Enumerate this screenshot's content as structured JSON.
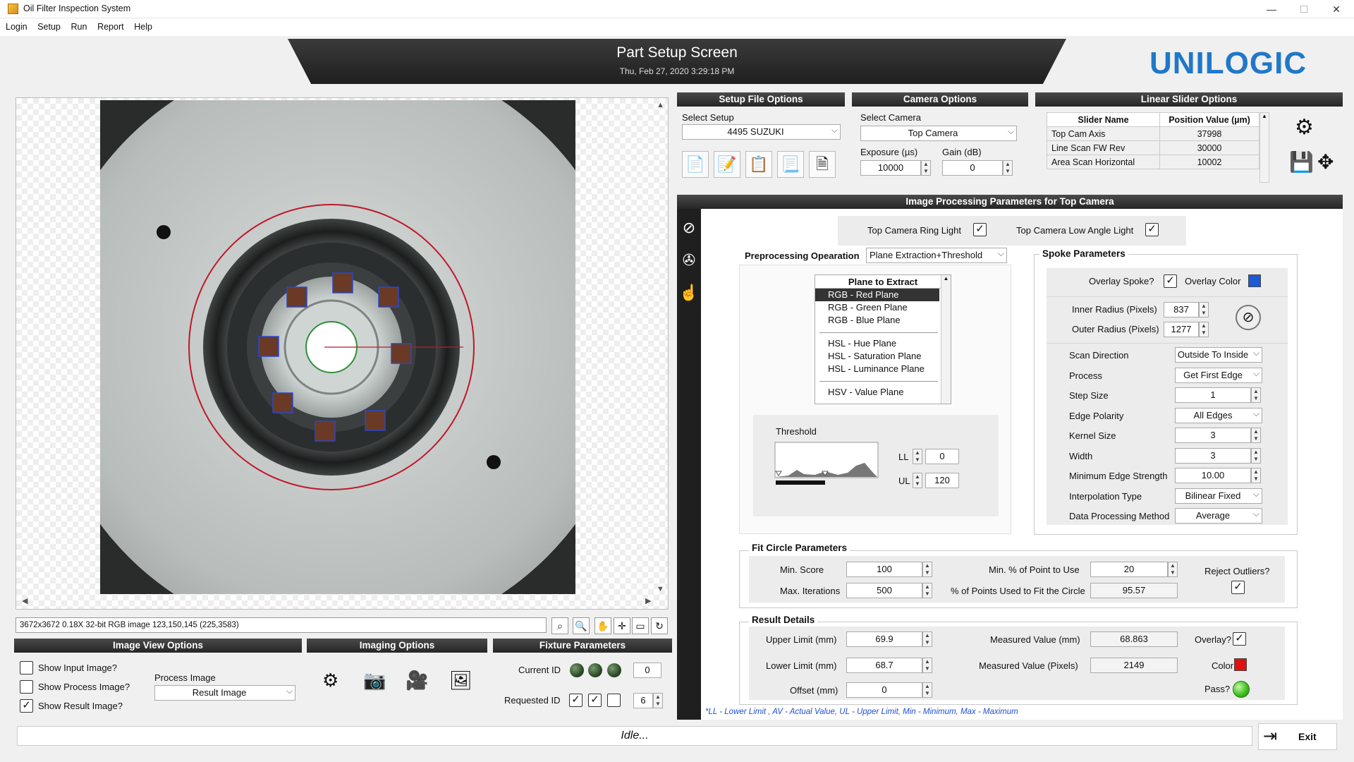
{
  "window": {
    "title": "Oil Filter Inspection System",
    "minimize": "—",
    "maximize": "☐",
    "close": "✕"
  },
  "menu": [
    "Login",
    "Setup",
    "Run",
    "Report",
    "Help"
  ],
  "header": {
    "title": "Part Setup Screen",
    "datetime": "Thu, Feb 27, 2020 3:29:18 PM"
  },
  "logo": {
    "text": "UNILOGIC",
    "color": "#1f78c8"
  },
  "viewer": {
    "info": "3672x3672 0.18X 32-bit RGB image 123,150,145    (225,3583)"
  },
  "setup_file": {
    "header": "Setup File Options",
    "select_label": "Select Setup",
    "select_value": "4495 SUZUKI",
    "buttons": [
      "new-file-icon",
      "edit-file-icon",
      "approve-file-icon",
      "download-file-icon",
      "delete-file-icon"
    ]
  },
  "camera": {
    "header": "Camera Options",
    "select_label": "Select Camera",
    "select_value": "Top Camera",
    "exposure_label": "Exposure (µs)",
    "exposure_value": "10000",
    "gain_label": "Gain (dB)",
    "gain_value": "0"
  },
  "linear_slider": {
    "header": "Linear Slider Options",
    "col_name": "Slider Name",
    "col_value": "Position Value (µm)",
    "rows": [
      {
        "name": "Top Cam Axis",
        "value": "37998"
      },
      {
        "name": "Line Scan FW Rev",
        "value": "30000"
      },
      {
        "name": "Area Scan Horizontal",
        "value": "10002"
      }
    ]
  },
  "ipp": {
    "header": "Image Processing Parameters for Top Camera",
    "ring_light_label": "Top Camera Ring Light",
    "ring_light": "✓",
    "low_angle_label": "Top Camera Low Angle Light",
    "low_angle": "✓",
    "preproc_label": "Preprocessing Opearation",
    "preproc_value": "Plane Extraction+Threshold",
    "plane_header": "Plane to Extract",
    "planes": [
      "RGB - Red Plane",
      "RGB - Green Plane",
      "RGB - Blue Plane",
      "HSL - Hue Plane",
      "HSL - Saturation Plane",
      "HSL - Luminance Plane",
      "HSV - Value Plane"
    ],
    "threshold_label": "Threshold",
    "ll_label": "LL",
    "ll_value": "0",
    "ul_label": "UL",
    "ul_value": "120"
  },
  "spoke": {
    "title": "Spoke Parameters",
    "overlay_label": "Overlay Spoke?",
    "overlay": "✓",
    "overlay_color_label": "Overlay Color",
    "overlay_color": "#1c5bd6",
    "inner_label": "Inner Radius (Pixels)",
    "inner_value": "837",
    "outer_label": "Outer Radius (Pixels)",
    "outer_value": "1277",
    "params": [
      {
        "label": "Scan Direction",
        "value": "Outside To Inside",
        "kind": "combo"
      },
      {
        "label": "Process",
        "value": "Get First Edge",
        "kind": "combo"
      },
      {
        "label": "Step Size",
        "value": "1",
        "kind": "spin"
      },
      {
        "label": "Edge Polarity",
        "value": "All Edges",
        "kind": "combo"
      },
      {
        "label": "Kernel Size",
        "value": "3",
        "kind": "spin"
      },
      {
        "label": "Width",
        "value": "3",
        "kind": "spin"
      },
      {
        "label": "Minimum Edge Strength",
        "value": "10.00",
        "kind": "spin"
      },
      {
        "label": "Interpolation Type",
        "value": "Bilinear Fixed",
        "kind": "combo"
      },
      {
        "label": "Data Processing Method",
        "value": "Average",
        "kind": "combo"
      }
    ]
  },
  "fit_circle": {
    "title": "Fit Circle Parameters",
    "min_score_label": "Min. Score",
    "min_score": "100",
    "max_iter_label": "Max. Iterations",
    "max_iter": "500",
    "min_pct_label": "Min. % of Point to Use",
    "min_pct": "20",
    "pct_used_label": "% of Points Used to Fit the Circle",
    "pct_used": "95.57",
    "reject_label": "Reject Outliers?",
    "reject": "✓"
  },
  "result": {
    "title": "Result Details",
    "upper_label": "Upper Limit (mm)",
    "upper": "69.9",
    "lower_label": "Lower Limit (mm)",
    "lower": "68.7",
    "offset_label": "Offset (mm)",
    "offset": "0",
    "meas_mm_label": "Measured Value (mm)",
    "meas_mm": "68.863",
    "meas_px_label": "Measured Value (Pixels)",
    "meas_px": "2149",
    "overlay_label": "Overlay?",
    "overlay": "✓",
    "color_label": "Color",
    "color": "#e01010",
    "pass_label": "Pass?",
    "pass_color": "#3fc21f"
  },
  "legend_note": "*LL - Lower Limit , AV - Actual Value, UL - Upper Limit, Min - Minimum, Max - Maximum",
  "image_view": {
    "header": "Image View Options",
    "show_input": "Show Input Image?",
    "show_input_checked": "",
    "show_process": "Show Process Image?",
    "show_process_checked": "",
    "show_result": "Show Result Image?",
    "show_result_checked": "✓",
    "process_label": "Process Image",
    "process_value": "Result Image"
  },
  "imaging": {
    "header": "Imaging Options"
  },
  "fixture": {
    "header": "Fixture Parameters",
    "current_label": "Current ID",
    "current_value": "0",
    "requested_label": "Requested ID",
    "requested_value": "6",
    "req_checks": [
      "✓",
      "✓",
      ""
    ]
  },
  "status": {
    "text": "Idle...",
    "exit_label": "Exit"
  }
}
